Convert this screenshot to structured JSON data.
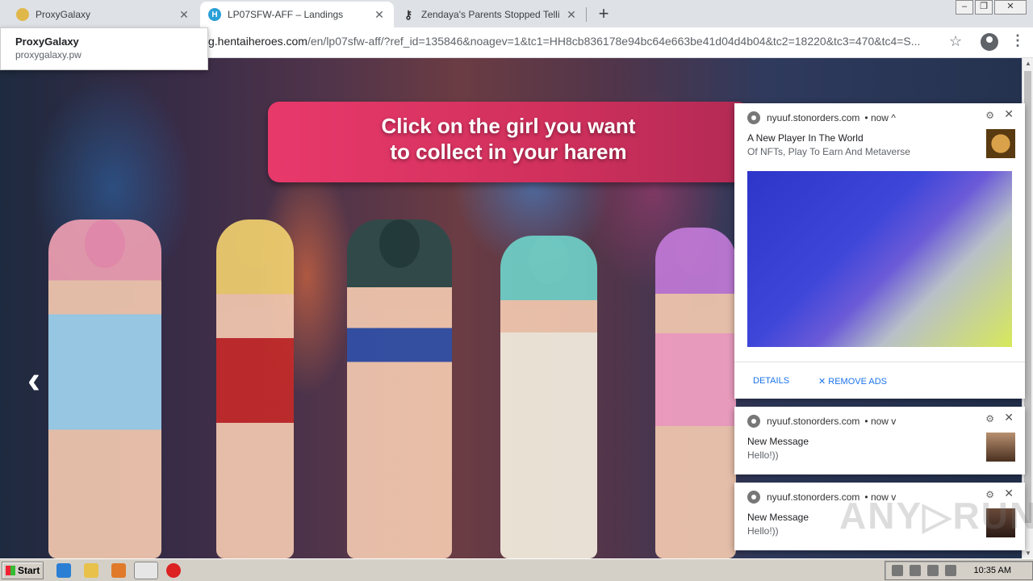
{
  "tabs": [
    {
      "title": "ProxyGalaxy",
      "favicon": "globe-icon",
      "color": "#e0b84a"
    },
    {
      "title": "LP07SFW-AFF – Landings",
      "favicon": "hh-icon",
      "color": "#2aa0d8",
      "active": true
    },
    {
      "title": "Zendaya's Parents Stopped Telling H",
      "favicon": "key-icon",
      "color": "#333333"
    }
  ],
  "toolbar": {
    "url_domain": "g.hentaiheroes.com",
    "url_path": "/en/lp07sfw-aff/?ref_id=135846&noagev=1&tc1=HH8cb836178e94bc64e663be41d04d4b04&tc2=18220&tc3=470&tc4=S..."
  },
  "popup": {
    "title": "ProxyGalaxy",
    "subtitle": "proxygalaxy.pw"
  },
  "page": {
    "banner_line1": "Click on the girl you want",
    "banner_line2": "to collect in your harem",
    "prev_arrow": "‹"
  },
  "notifications": [
    {
      "site": "nyuuf.stonorders.com",
      "time": "now",
      "chevron": "^",
      "title": "A New Player In The World",
      "body": "Of NFTs, Play To Earn And Metaverse",
      "actions": [
        "DETAILS",
        "REMOVE ADS"
      ]
    },
    {
      "site": "nyuuf.stonorders.com",
      "time": "now",
      "chevron": "v",
      "title": "New Message",
      "body": "Hello!))"
    },
    {
      "site": "nyuuf.stonorders.com",
      "time": "now",
      "chevron": "v",
      "title": "New Message",
      "body": "Hello!))"
    }
  ],
  "taskbar": {
    "start_label": "Start",
    "clock": "10:35 AM"
  }
}
